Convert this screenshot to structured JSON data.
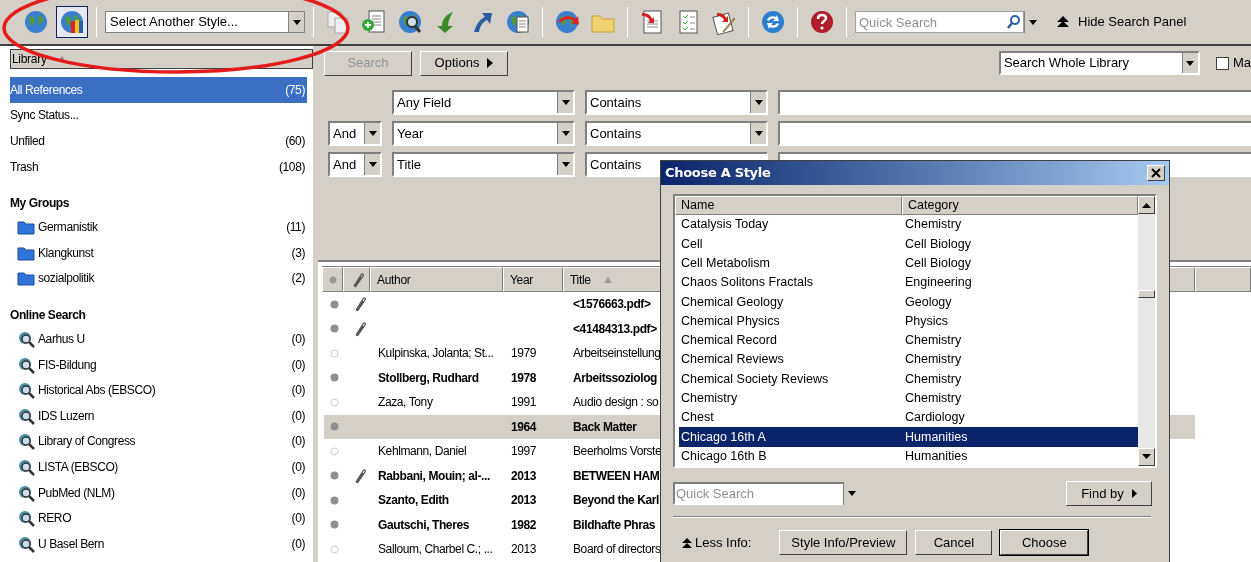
{
  "toolbar": {
    "style_buttons": [
      {
        "selected": false
      },
      {
        "selected": true
      }
    ],
    "style_dropdown": {
      "value": "Select Another Style..."
    },
    "quick_search": {
      "placeholder": "Quick Search"
    },
    "hide_search_panel": "Hide Search Panel"
  },
  "sidebar": {
    "header": "Library",
    "sections": [
      {
        "items": [
          {
            "kind": "plain",
            "label": "All References",
            "count": "(75)",
            "selected": true
          },
          {
            "kind": "plain",
            "label": "Sync Status...",
            "selected": false
          },
          {
            "kind": "plain",
            "label": "Unfiled",
            "count": "(60)",
            "selected": false
          },
          {
            "kind": "plain",
            "label": "Trash",
            "count": "(108)",
            "selected": false
          }
        ]
      },
      {
        "title": "My Groups",
        "items": [
          {
            "kind": "folder",
            "label": "Germanistik",
            "count": "(11)",
            "selected": false
          },
          {
            "kind": "folder",
            "label": "Klangkunst",
            "count": "(3)",
            "selected": false
          },
          {
            "kind": "folder",
            "label": "sozialpolitik",
            "count": "(2)",
            "selected": false
          }
        ]
      },
      {
        "title": "Online Search",
        "items": [
          {
            "kind": "online",
            "label": "Aarhus U",
            "count": "(0)",
            "selected": false
          },
          {
            "kind": "online",
            "label": "FIS-Bildung",
            "count": "(0)",
            "selected": false
          },
          {
            "kind": "online",
            "label": "Historical Abs (EBSCO)",
            "count": "(0)",
            "selected": false
          },
          {
            "kind": "online",
            "label": "IDS Luzern",
            "count": "(0)",
            "selected": false
          },
          {
            "kind": "online",
            "label": "Library of Congress",
            "count": "(0)",
            "selected": false
          },
          {
            "kind": "online",
            "label": "LISTA (EBSCO)",
            "count": "(0)",
            "selected": false
          },
          {
            "kind": "online",
            "label": "PubMed (NLM)",
            "count": "(0)",
            "selected": false
          },
          {
            "kind": "online",
            "label": "RERO",
            "count": "(0)",
            "selected": false
          },
          {
            "kind": "online",
            "label": "U Basel Bern",
            "count": "(0)",
            "selected": false
          }
        ]
      }
    ]
  },
  "search_panel": {
    "search_button": {
      "label": "Search",
      "disabled": true
    },
    "options_button": "Options",
    "scope": "Search Whole Library",
    "match_checkbox": {
      "label": "Ma",
      "checked": false
    },
    "rows": [
      {
        "field": "Any Field",
        "condition": "Contains"
      },
      {
        "operator": "And",
        "field": "Year",
        "condition": "Contains"
      },
      {
        "operator": "And",
        "field": "Title",
        "condition": "Contains"
      }
    ]
  },
  "reference_table": {
    "columns": [
      "Author",
      "Year",
      "Title"
    ],
    "rows": [
      {
        "read": false,
        "attachment": true,
        "title": "<1576663.pdf>",
        "selected": false
      },
      {
        "read": false,
        "attachment": true,
        "title": "<41484313.pdf>",
        "selected": false
      },
      {
        "read": true,
        "attachment": false,
        "author": "Kulpinska, Jolanta; St...",
        "year": "1979",
        "title": "Arbeitseinstellung",
        "selected": false
      },
      {
        "read": false,
        "attachment": false,
        "author": "Stollberg, Rudhard",
        "year": "1978",
        "title": "Arbeitssoziolog",
        "selected": false
      },
      {
        "read": true,
        "attachment": false,
        "author": "Zaza, Tony",
        "year": "1991",
        "title": "Audio design : so",
        "selected": false
      },
      {
        "read": false,
        "attachment": false,
        "year": "1964",
        "title": "Back Matter",
        "selected": true
      },
      {
        "read": true,
        "attachment": false,
        "author": "Kehlmann, Daniel",
        "year": "1997",
        "title": "Beerholms Vorste",
        "selected": false
      },
      {
        "read": false,
        "attachment": true,
        "author": "Rabbani, Mouin; al-...",
        "year": "2013",
        "title": "BETWEEN HAM",
        "selected": false
      },
      {
        "read": false,
        "attachment": false,
        "author": "Szanto, Edith",
        "year": "2013",
        "title": "Beyond the Karl",
        "selected": false
      },
      {
        "read": false,
        "attachment": false,
        "author": "Gautschi, Theres",
        "year": "1982",
        "title": "Bildhafte Phras",
        "selected": false
      },
      {
        "read": true,
        "attachment": false,
        "author": "Salloum, Charbel C.; ...",
        "year": "2013",
        "title": "Board of directors",
        "selected": false
      }
    ]
  },
  "style_dialog": {
    "title": "Choose A Style",
    "columns": [
      "Name",
      "Category"
    ],
    "rows": [
      {
        "name": "Catalysis Today",
        "category": "Chemistry",
        "selected": false
      },
      {
        "name": "Cell",
        "category": "Cell Biology",
        "selected": false
      },
      {
        "name": "Cell Metabolism",
        "category": "Cell Biology",
        "selected": false
      },
      {
        "name": "Chaos Solitons Fractals",
        "category": "Engineering",
        "selected": false
      },
      {
        "name": "Chemical Geology",
        "category": "Geology",
        "selected": false
      },
      {
        "name": "Chemical Physics",
        "category": "Physics",
        "selected": false
      },
      {
        "name": "Chemical Record",
        "category": "Chemistry",
        "selected": false
      },
      {
        "name": "Chemical Reviews",
        "category": "Chemistry",
        "selected": false
      },
      {
        "name": "Chemical Society Reviews",
        "category": "Chemistry",
        "selected": false
      },
      {
        "name": "Chemistry",
        "category": "Chemistry",
        "selected": false
      },
      {
        "name": "Chest",
        "category": "Cardiology",
        "selected": false
      },
      {
        "name": "Chicago 16th A",
        "category": "Humanities",
        "selected": true
      },
      {
        "name": "Chicago 16th B",
        "category": "Humanities",
        "selected": false
      }
    ],
    "quick_search": {
      "placeholder": "Quick Search"
    },
    "find_by_button": "Find by",
    "less_info": "Less Info:",
    "buttons": [
      "Style Info/Preview",
      "Cancel",
      "Choose"
    ]
  },
  "annotation": {
    "kind": "ellipse"
  }
}
